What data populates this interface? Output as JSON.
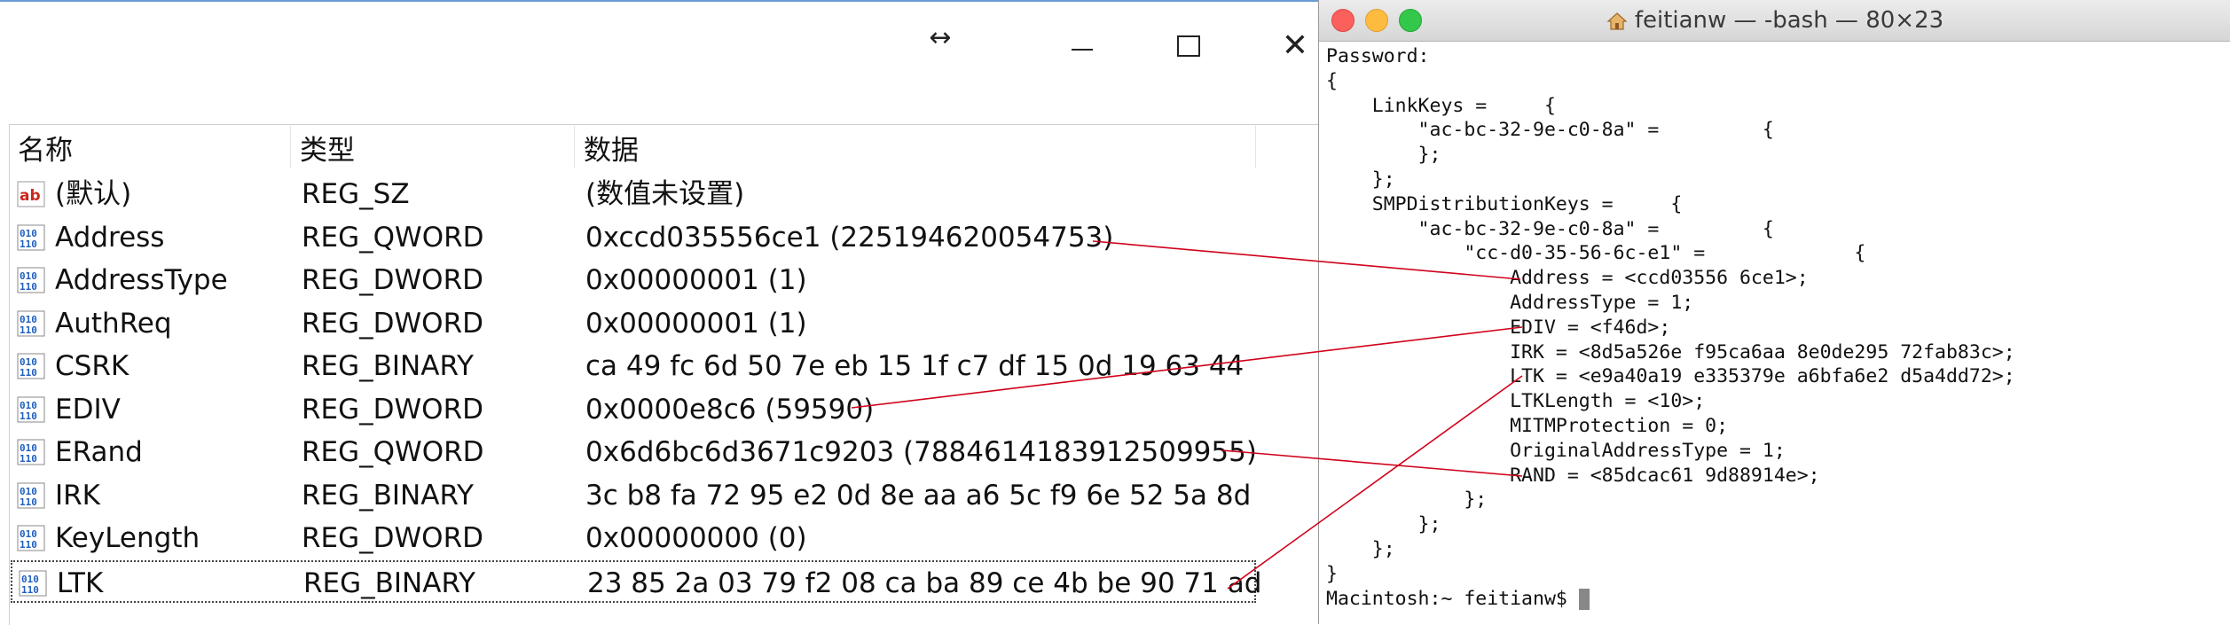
{
  "regedit": {
    "columns": [
      "名称",
      "类型",
      "数据"
    ],
    "rows": [
      {
        "icon": "string-value-icon",
        "name": "(默认)",
        "type": "REG_SZ",
        "data": "(数值未设置)"
      },
      {
        "icon": "binary-value-icon",
        "name": "Address",
        "type": "REG_QWORD",
        "data": "0xccd035556ce1 (225194620054753)"
      },
      {
        "icon": "binary-value-icon",
        "name": "AddressType",
        "type": "REG_DWORD",
        "data": "0x00000001 (1)"
      },
      {
        "icon": "binary-value-icon",
        "name": "AuthReq",
        "type": "REG_DWORD",
        "data": "0x00000001 (1)"
      },
      {
        "icon": "binary-value-icon",
        "name": "CSRK",
        "type": "REG_BINARY",
        "data": "ca 49 fc 6d 50 7e eb 15 1f c7 df 15 0d 19 63 44"
      },
      {
        "icon": "binary-value-icon",
        "name": "EDIV",
        "type": "REG_DWORD",
        "data": "0x0000e8c6 (59590)"
      },
      {
        "icon": "binary-value-icon",
        "name": "ERand",
        "type": "REG_QWORD",
        "data": "0x6d6bc6d3671c9203 (7884614183912509955)"
      },
      {
        "icon": "binary-value-icon",
        "name": "IRK",
        "type": "REG_BINARY",
        "data": "3c b8 fa 72 95 e2 0d 8e aa a6 5c f9 6e 52 5a 8d"
      },
      {
        "icon": "binary-value-icon",
        "name": "KeyLength",
        "type": "REG_DWORD",
        "data": "0x00000000 (0)"
      },
      {
        "icon": "binary-value-icon",
        "name": "LTK",
        "type": "REG_BINARY",
        "data": "23 85 2a 03 79 f2 08 ca ba 89 ce 4b be 90 71 ad",
        "selected": true
      }
    ]
  },
  "terminal": {
    "title": "feitianw — -bash — 80×23",
    "lines": [
      "Password:",
      "{",
      "    LinkKeys =     {",
      "        \"ac-bc-32-9e-c0-8a\" =         {",
      "        };",
      "    };",
      "    SMPDistributionKeys =     {",
      "        \"ac-bc-32-9e-c0-8a\" =         {",
      "            \"cc-d0-35-56-6c-e1\" =             {",
      "                Address = <ccd03556 6ce1>;",
      "                AddressType = 1;",
      "                EDIV = <f46d>;",
      "                IRK = <8d5a526e f95ca6aa 8e0de295 72fab83c>;",
      "                LTK = <e9a40a19 e335379e a6bfa6e2 d5a4dd72>;",
      "                LTKLength = <10>;",
      "                MITMProtection = 0;",
      "                OriginalAddressType = 1;",
      "                RAND = <85dcac61 9d88914e>;",
      "            };",
      "        };",
      "    };",
      "}"
    ],
    "prompt": "Macintosh:~ feitianw$ "
  },
  "colors": {
    "annotation_line": "#d0021b",
    "titlebar_accent": "#6b9bd6"
  }
}
